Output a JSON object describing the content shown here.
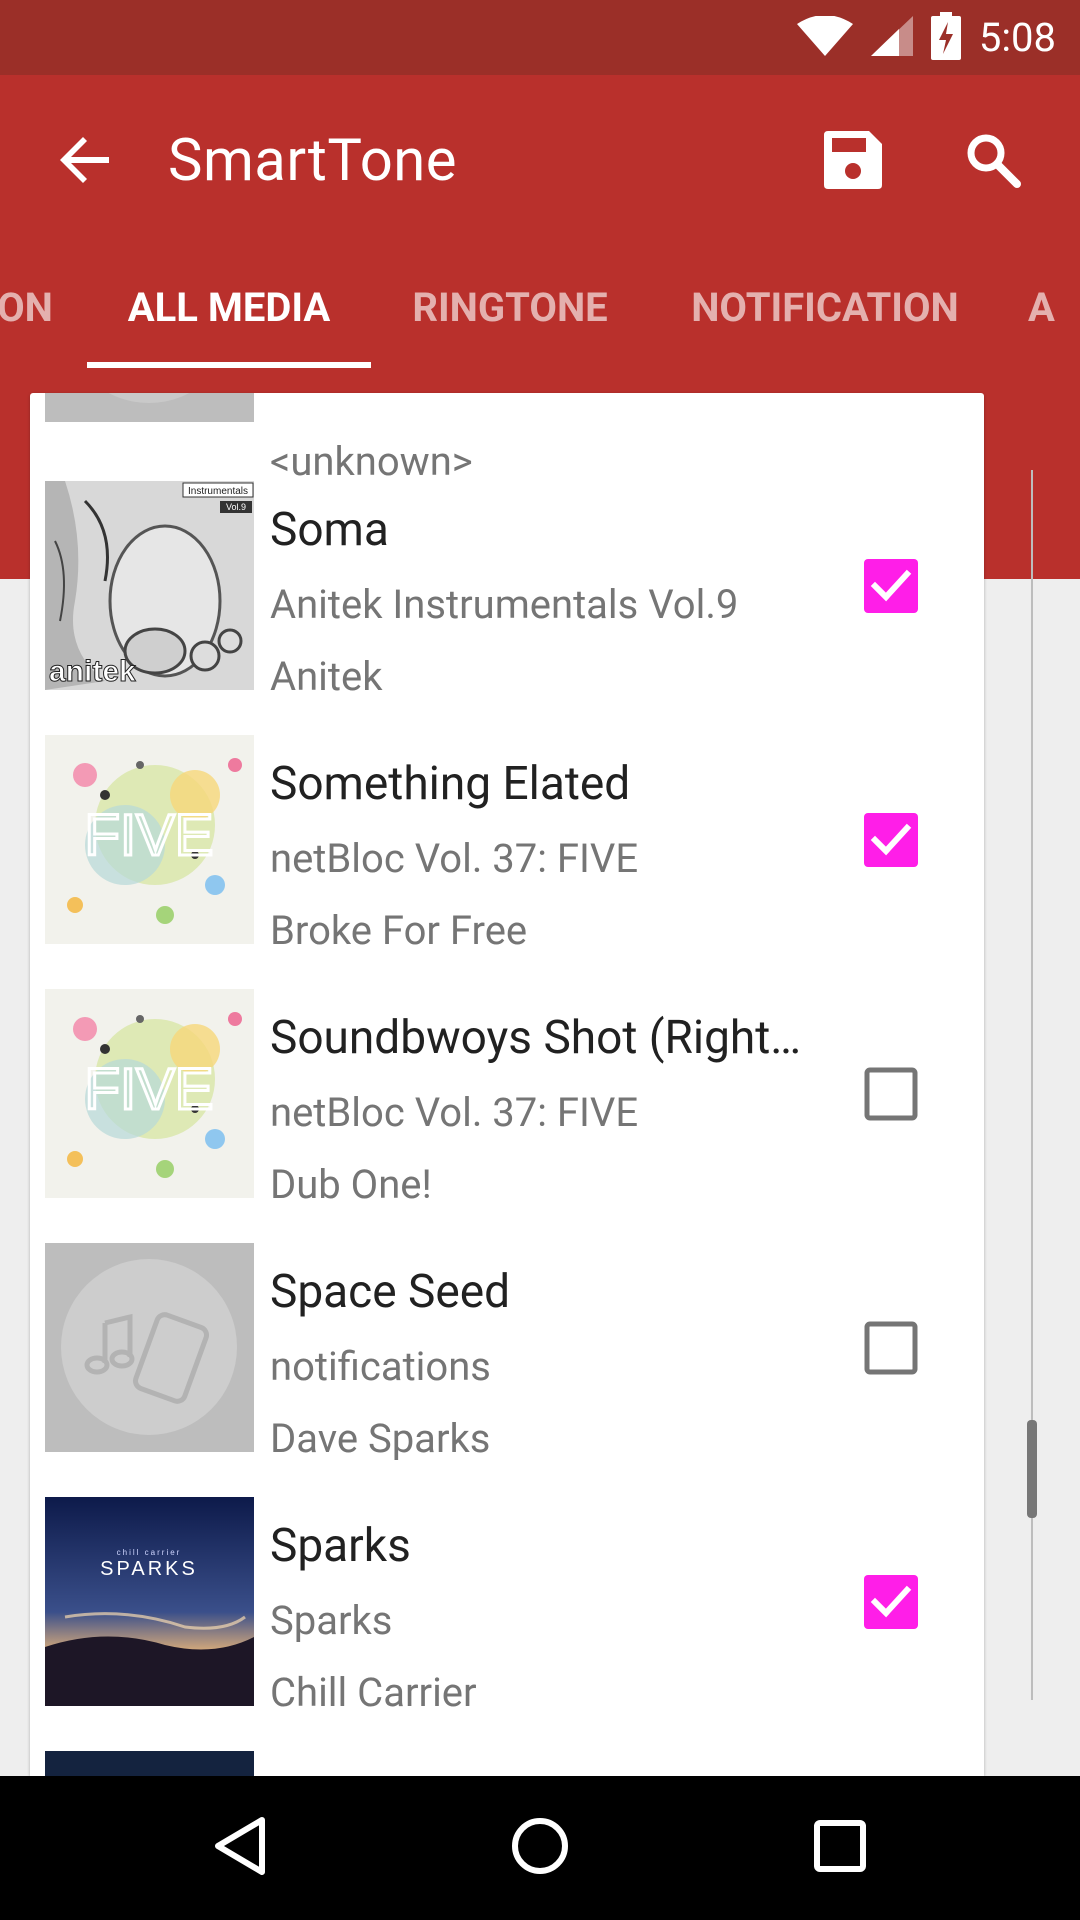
{
  "status": {
    "time": "5:08"
  },
  "toolbar": {
    "title": "SmartTone"
  },
  "tabs": [
    {
      "label": "ON"
    },
    {
      "label": "ALL MEDIA"
    },
    {
      "label": "RINGTONE"
    },
    {
      "label": "NOTIFICATION"
    },
    {
      "label": "A"
    }
  ],
  "list": {
    "partial_top": {
      "line": "<unknown>"
    },
    "items": [
      {
        "title": "Soma",
        "album": "Anitek Instrumentals Vol.9",
        "artist": "Anitek",
        "checked": true,
        "art": "anitek-cover",
        "art_text": "anitek",
        "art_badge1": "Instrumentals",
        "art_badge2": "Vol.9"
      },
      {
        "title": "Something Elated",
        "album": "netBloc Vol. 37: FIVE",
        "artist": "Broke For Free",
        "checked": true,
        "art": "netbloc-cover",
        "art_text": "FIVE"
      },
      {
        "title": "Soundbwoys Shot (Right…",
        "album": "netBloc Vol. 37: FIVE",
        "artist": "Dub One!",
        "checked": false,
        "art": "netbloc-cover",
        "art_text": "FIVE"
      },
      {
        "title": "Space Seed",
        "album": "notifications",
        "artist": "Dave Sparks",
        "checked": false,
        "art": "default-music-icon"
      },
      {
        "title": "Sparks",
        "album": "Sparks",
        "artist": "Chill Carrier",
        "checked": true,
        "art": "sparks-cover",
        "art_text": "SPARKS",
        "art_subtext": "chill carrier"
      }
    ]
  },
  "colors": {
    "statusbar": "#9b2f28",
    "appbar": "#b9302c",
    "checkbox_checked": "#ff1ee8",
    "checkbox_unchecked": "#757575"
  }
}
